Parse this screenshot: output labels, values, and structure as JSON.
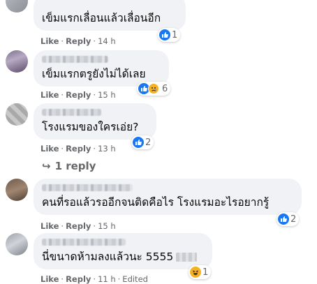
{
  "comments": [
    {
      "text": "เข็มแรกเลื่อนแล้วเลื่อนอีก",
      "actions": {
        "like": "Like",
        "reply": "Reply",
        "time": "14 h"
      },
      "reactions": {
        "count": "1",
        "icons": [
          "like-icon"
        ]
      }
    },
    {
      "text": "เข็มแรกตรูยังไม่ได้เลย",
      "actions": {
        "like": "Like",
        "reply": "Reply",
        "time": "15 h"
      },
      "reactions": {
        "count": "6",
        "icons": [
          "like-icon",
          "sad-icon"
        ]
      }
    },
    {
      "text": "โรงแรมของใครเอ่ย?",
      "actions": {
        "like": "Like",
        "reply": "Reply",
        "time": "13 h"
      },
      "reactions": {
        "count": "2",
        "icons": [
          "like-icon"
        ]
      },
      "replies_link": "1 reply"
    },
    {
      "text": "คนที่รอแล้วรออีกจนติดคือไร โรงแรมอะไรอยากรู้",
      "actions": {
        "like": "Like",
        "reply": "Reply",
        "time": "15 h"
      },
      "reactions": {
        "count": "2",
        "icons": [
          "like-icon"
        ]
      }
    },
    {
      "text": "นี่ขนาดห้ามลงแล้วนะ 5555",
      "actions": {
        "like": "Like",
        "reply": "Reply",
        "time": "11 h",
        "edited": "Edited"
      },
      "reactions": {
        "count": "1",
        "icons": [
          "haha-icon"
        ]
      }
    }
  ],
  "colors": {
    "bubble": "#f0f2f5",
    "meta": "#65676b",
    "like": "#1877f2",
    "emoji": "#f7b125"
  }
}
